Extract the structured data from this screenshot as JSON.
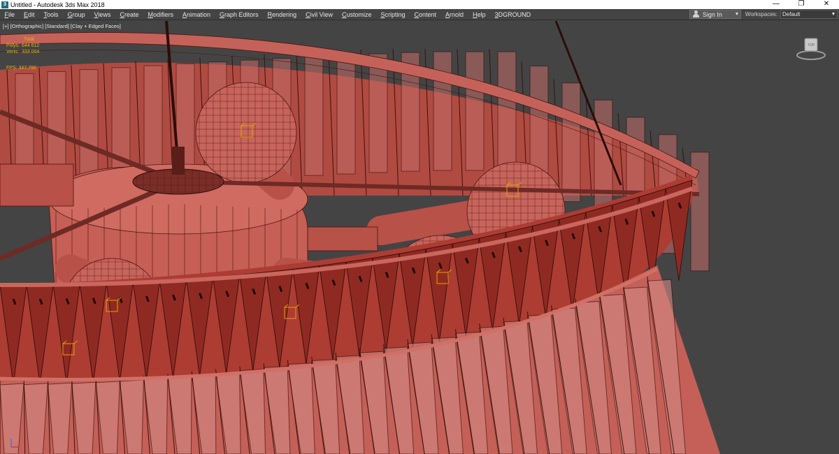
{
  "window": {
    "title": "Untitled - Autodesk 3ds Max 2018",
    "app_icon": "3",
    "minimize": "—",
    "maximize": "❐",
    "close": "✕"
  },
  "menu": {
    "items": [
      "File",
      "Edit",
      "Tools",
      "Group",
      "Views",
      "Create",
      "Modifiers",
      "Animation",
      "Graph Editors",
      "Rendering",
      "Civil View",
      "Customize",
      "Scripting",
      "Content",
      "Arnold",
      "Help",
      "3DGROUND"
    ],
    "sign_in": "Sign In",
    "workspaces_label": "Workspaces:",
    "workspaces_value": "Default"
  },
  "viewport": {
    "label": "[+] [Orthographic] [Standard] [Clay + Edged Faces]",
    "stats_header": "Total",
    "polys_label": "Polys:",
    "polys_value": "644 612",
    "verts_label": "Verts:",
    "verts_value": "333 004",
    "fps_label": "FPS:",
    "fps_value": "347,790",
    "viewcube_face": "TOP"
  },
  "colors": {
    "viewport_bg": "#444444",
    "clay": "#c05a50",
    "wire": "#4a1410",
    "stats": "#e8b800",
    "selection": "#e8a000"
  },
  "icons": {
    "app": "3ds-max-icon",
    "user": "user-icon",
    "dropdown": "chevron-down-icon",
    "viewcube": "viewcube-icon",
    "axis": "axis-tripod-icon"
  }
}
